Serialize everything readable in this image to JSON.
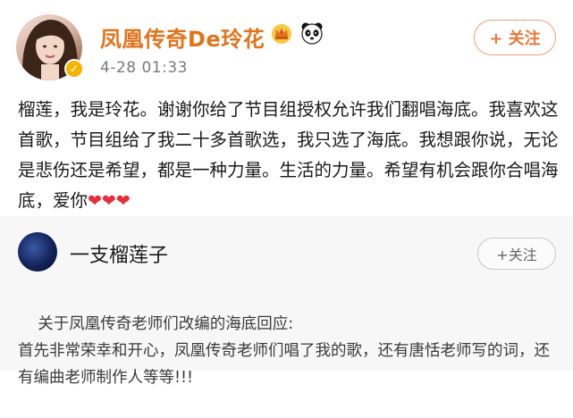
{
  "post1": {
    "username": "凤凰传奇De玲花",
    "timestamp": "4-28 01:33",
    "follow_label": "+ 关注",
    "content": "榴莲，我是玲花。谢谢你给了节目组授权允许我们翻唱海底。我喜欢这首歌，节目组给了我二十多首歌选，我只选了海底。我想跟你说，无论是悲伤还是希望，都是一种力量。生活的力量。希望有机会跟你合唱海底，爱你",
    "hearts": "❤❤❤",
    "badges": [
      "crown-badge-icon",
      "panda-badge-icon"
    ],
    "verified_icon": "verified-check-icon"
  },
  "post2": {
    "username": "一支榴莲子",
    "follow_label": "+关注",
    "content": "关于凤凰传奇老师们改编的海底回应:\n首先非常荣幸和开心，凤凰传奇老师们唱了我的歌，还有唐恬老师写的词，还有编曲老师制作人等等!!!"
  },
  "colors": {
    "username_accent": "#e0741c",
    "follow_accent": "#e8773a",
    "heart": "#e5303a",
    "post2_background": "#f7f7f7"
  }
}
